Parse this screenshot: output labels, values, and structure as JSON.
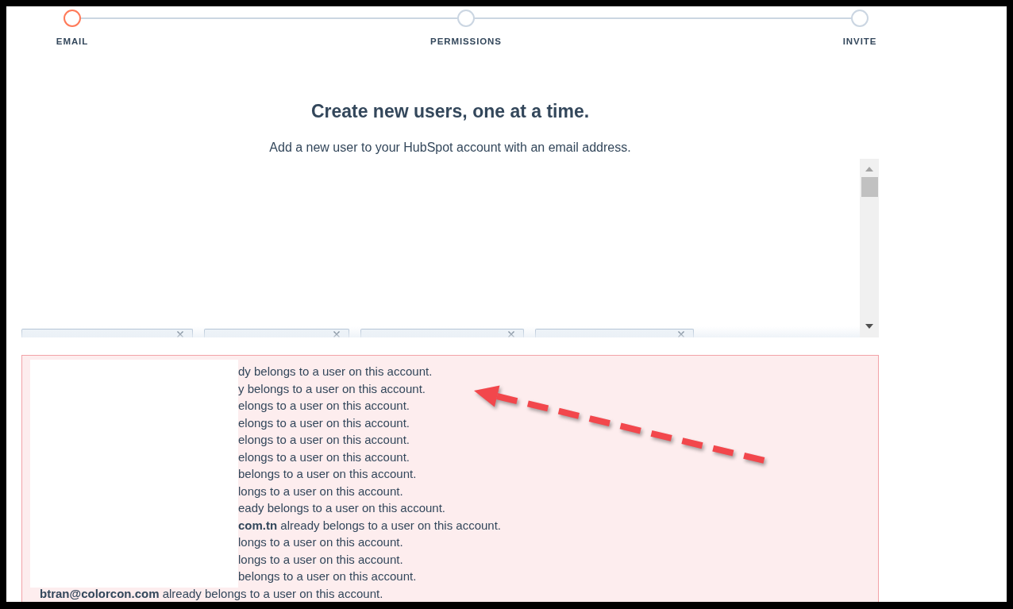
{
  "stepper": {
    "steps": [
      {
        "label": "EMAIL",
        "selected": true
      },
      {
        "label": "PERMISSIONS",
        "selected": false
      },
      {
        "label": "INVITE",
        "selected": false
      }
    ]
  },
  "heading": "Create new users, one at a time.",
  "subheading": "Add a new user to your HubSpot account with an email address.",
  "email_field": {
    "tags": [
      {
        "removable": true
      },
      {
        "removable": true
      },
      {
        "removable": true
      },
      {
        "removable": true
      }
    ]
  },
  "error_box": {
    "lines": [
      {
        "text": "dy belongs to a user on this account.",
        "redacted": true
      },
      {
        "text": "y belongs to a user on this account.",
        "redacted": true
      },
      {
        "text": "elongs to a user on this account.",
        "redacted": true
      },
      {
        "text": "elongs to a user on this account.",
        "redacted": true
      },
      {
        "text": "elongs to a user on this account.",
        "redacted": true
      },
      {
        "text": "elongs to a user on this account.",
        "redacted": true
      },
      {
        "text": "belongs to a user on this account.",
        "redacted": true
      },
      {
        "text": "longs to a user on this account.",
        "redacted": true
      },
      {
        "text": "eady belongs to a user on this account.",
        "redacted": true
      },
      {
        "text": "**com.tn** already belongs to a user on this account.",
        "redacted": true
      },
      {
        "text": "longs to a user on this account.",
        "redacted": true
      },
      {
        "text": "longs to a user on this account.",
        "redacted": true
      },
      {
        "text": "belongs to a user on this account.",
        "redacted": true
      },
      {
        "text": "**btran@colorcon.com** already belongs to a user on this account.",
        "redacted": false
      }
    ]
  },
  "annotations": [
    {
      "kind": "dashed-arrow"
    }
  ]
}
